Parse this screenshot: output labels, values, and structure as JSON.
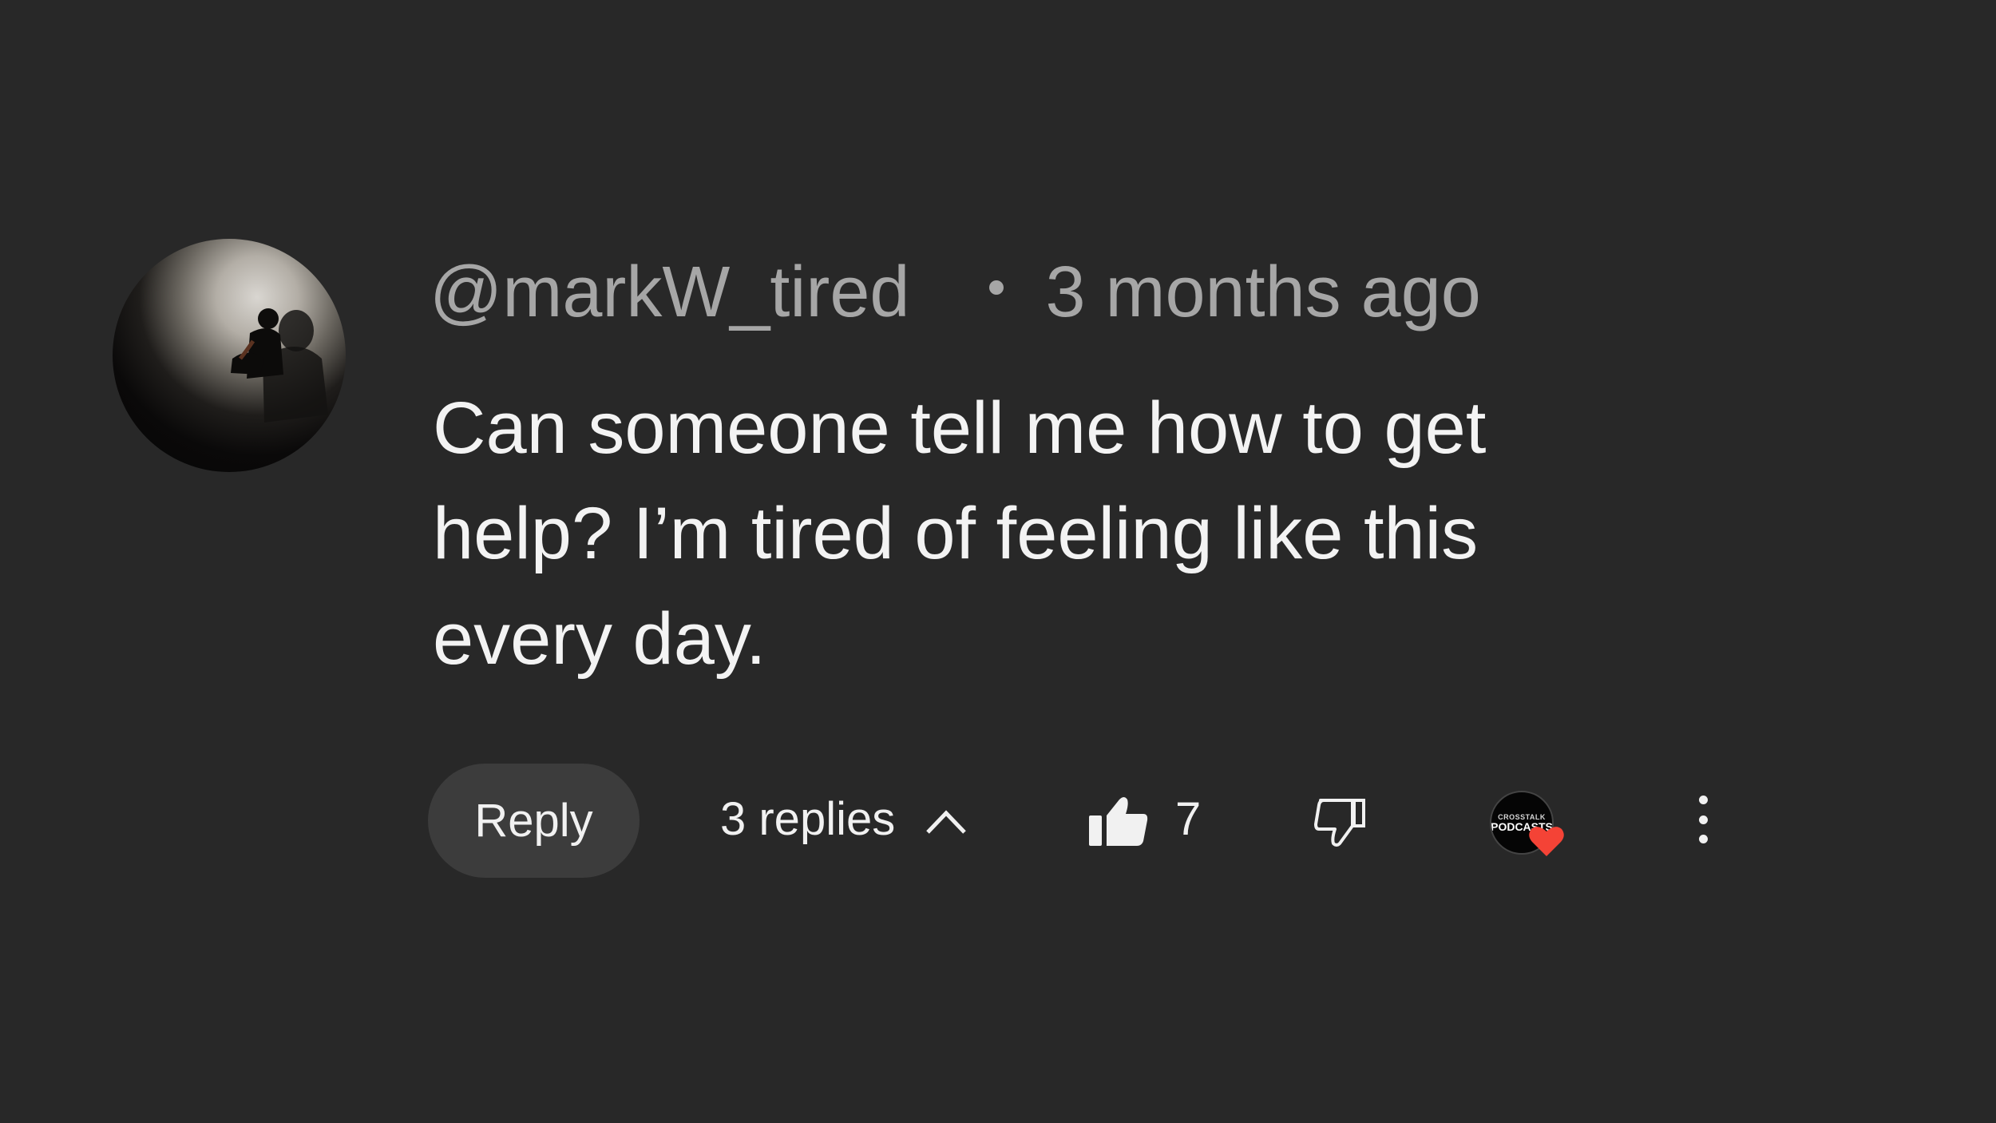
{
  "comment": {
    "author": "@markW_tired",
    "timestamp": "3 months ago",
    "text": "Can someone tell me how to get\nhelp? I’m tired of feeling like this\nevery day.",
    "avatar_icon": "silhouette-person-avatar"
  },
  "actions": {
    "reply_label": "Reply",
    "replies_label": "3 replies",
    "replies_icon": "chevron-up-icon",
    "like_icon": "thumbs-up-filled-icon",
    "like_count": "7",
    "dislike_icon": "thumbs-down-outline-icon",
    "more_icon": "vertical-ellipsis-icon"
  },
  "creator_heart": {
    "brand_top": "CROSSTALK",
    "brand_main": "PODCASTS",
    "heart_color": "#f44336"
  },
  "colors": {
    "background": "#282828",
    "meta_text": "#a6a6a6",
    "body_text": "#f3f3f3",
    "button_bg": "#3c3c3c"
  }
}
